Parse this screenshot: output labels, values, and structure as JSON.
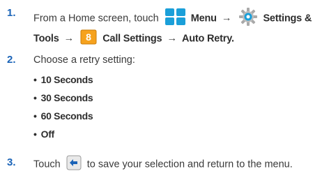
{
  "steps": [
    {
      "number": "1.",
      "intro": "From a Home screen, touch",
      "menu_label": "Menu",
      "settings_label_a": "Settings &",
      "settings_label_b": "Tools",
      "key_digit": "8",
      "call_settings_label": "Call Settings",
      "auto_retry_label": "Auto Retry.",
      "arrow": "→"
    },
    {
      "number": "2.",
      "text": "Choose a retry setting:",
      "options": [
        "10 Seconds",
        "30 Seconds",
        "60 Seconds",
        "Off"
      ]
    },
    {
      "number": "3.",
      "before": "Touch",
      "after": "to save your selection and return to the menu."
    }
  ],
  "bullet": "•",
  "icons": {
    "menu": "menu-grid-icon",
    "settings": "settings-gear-icon",
    "key": "number-key-icon",
    "back": "back-arrow-icon"
  },
  "colors": {
    "step_number": "#1a63b7",
    "menu_icon": "#1a9fd9",
    "key_fill": "#f6a21d",
    "text": "#3a3a3a"
  }
}
